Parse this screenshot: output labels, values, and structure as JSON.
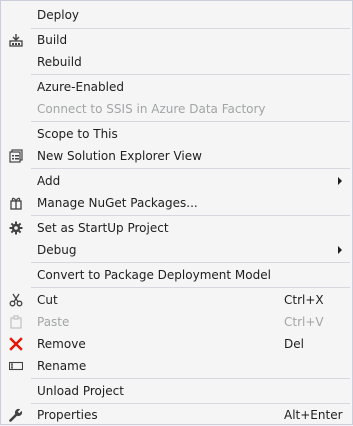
{
  "menu": {
    "items": [
      {
        "label": "Deploy",
        "icon": ""
      },
      {
        "label": "Build",
        "icon": "build-icon"
      },
      {
        "label": "Rebuild",
        "icon": ""
      },
      {
        "label": "Azure-Enabled",
        "icon": ""
      },
      {
        "label": "Connect to SSIS in Azure Data Factory",
        "icon": "",
        "disabled": true
      },
      {
        "label": "Scope to This",
        "icon": ""
      },
      {
        "label": "New Solution Explorer View",
        "icon": "solution-explorer-icon"
      },
      {
        "label": "Add",
        "icon": "",
        "submenu": true
      },
      {
        "label": "Manage NuGet Packages...",
        "icon": "nuget-icon"
      },
      {
        "label": "Set as StartUp Project",
        "icon": "gear-icon"
      },
      {
        "label": "Debug",
        "icon": "",
        "submenu": true
      },
      {
        "label": "Convert to Package Deployment Model",
        "icon": ""
      },
      {
        "label": "Cut",
        "icon": "scissors-icon",
        "shortcut": "Ctrl+X"
      },
      {
        "label": "Paste",
        "icon": "clipboard-icon",
        "shortcut": "Ctrl+V",
        "disabled": true
      },
      {
        "label": "Remove",
        "icon": "red-x-icon",
        "shortcut": "Del"
      },
      {
        "label": "Rename",
        "icon": "rename-icon"
      },
      {
        "label": "Unload Project",
        "icon": ""
      },
      {
        "label": "Properties",
        "icon": "wrench-icon",
        "shortcut": "Alt+Enter"
      }
    ]
  },
  "colors": {
    "background": "#f5f5f5",
    "text": "#1e1e1e",
    "disabled_text": "#a2a4a5",
    "separator": "#d7d8de",
    "remove_icon": "#e51400"
  }
}
